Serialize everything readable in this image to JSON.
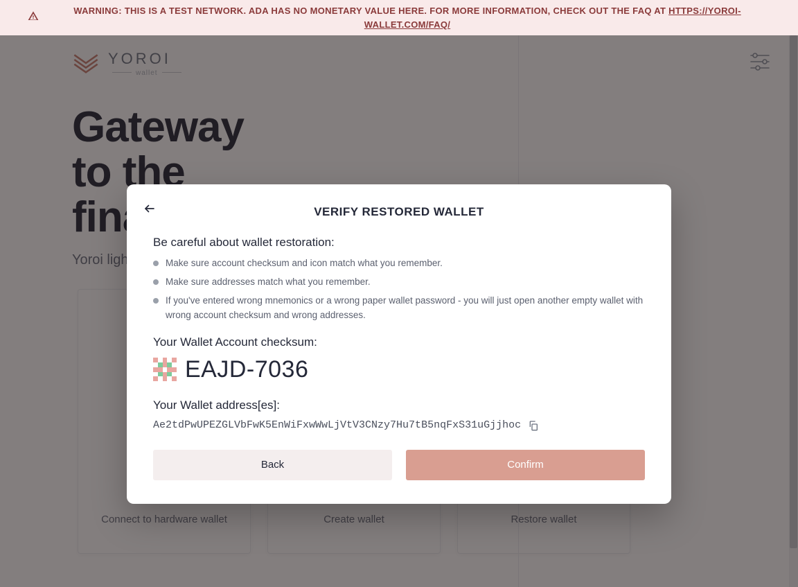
{
  "warning": {
    "prefix": "WARNING: THIS IS A TEST NETWORK. ADA HAS NO MONETARY VALUE HERE. FOR MORE INFORMATION, CHECK OUT THE FAQ AT ",
    "link_text": "HTTPS://YOROI-WALLET.COM/FAQ/"
  },
  "brand": {
    "name": "YOROI",
    "sub": "wallet"
  },
  "hero": {
    "title_line1": "Gateway",
    "title_line2": "to the",
    "title_line3": "financial world",
    "subtitle": "Yoroi light wallet for Cardano assets"
  },
  "cards": [
    {
      "label": "Connect to hardware wallet"
    },
    {
      "label": "Create wallet"
    },
    {
      "label": "Restore wallet"
    }
  ],
  "modal": {
    "title": "VERIFY RESTORED WALLET",
    "caution_heading": "Be careful about wallet restoration:",
    "bullets": [
      "Make sure account checksum and icon match what you remember.",
      "Make sure addresses match what you remember.",
      "If you've entered wrong mnemonics or a wrong paper wallet password - you will just open another empty wallet with wrong account checksum and wrong addresses."
    ],
    "checksum_label": "Your Wallet Account checksum:",
    "checksum_value": "EAJD-7036",
    "addresses_label": "Your Wallet address[es]:",
    "address": "Ae2tdPwUPEZGLVbFwK5EnWiFxwWwLjVtV3CNzy7Hu7tB5nqFxS31uGjjhoc",
    "back_label": "Back",
    "confirm_label": "Confirm"
  },
  "colors": {
    "accent": "#d99e91",
    "warning_bg": "#f9eaea",
    "warning_text": "#8a3a3a"
  }
}
